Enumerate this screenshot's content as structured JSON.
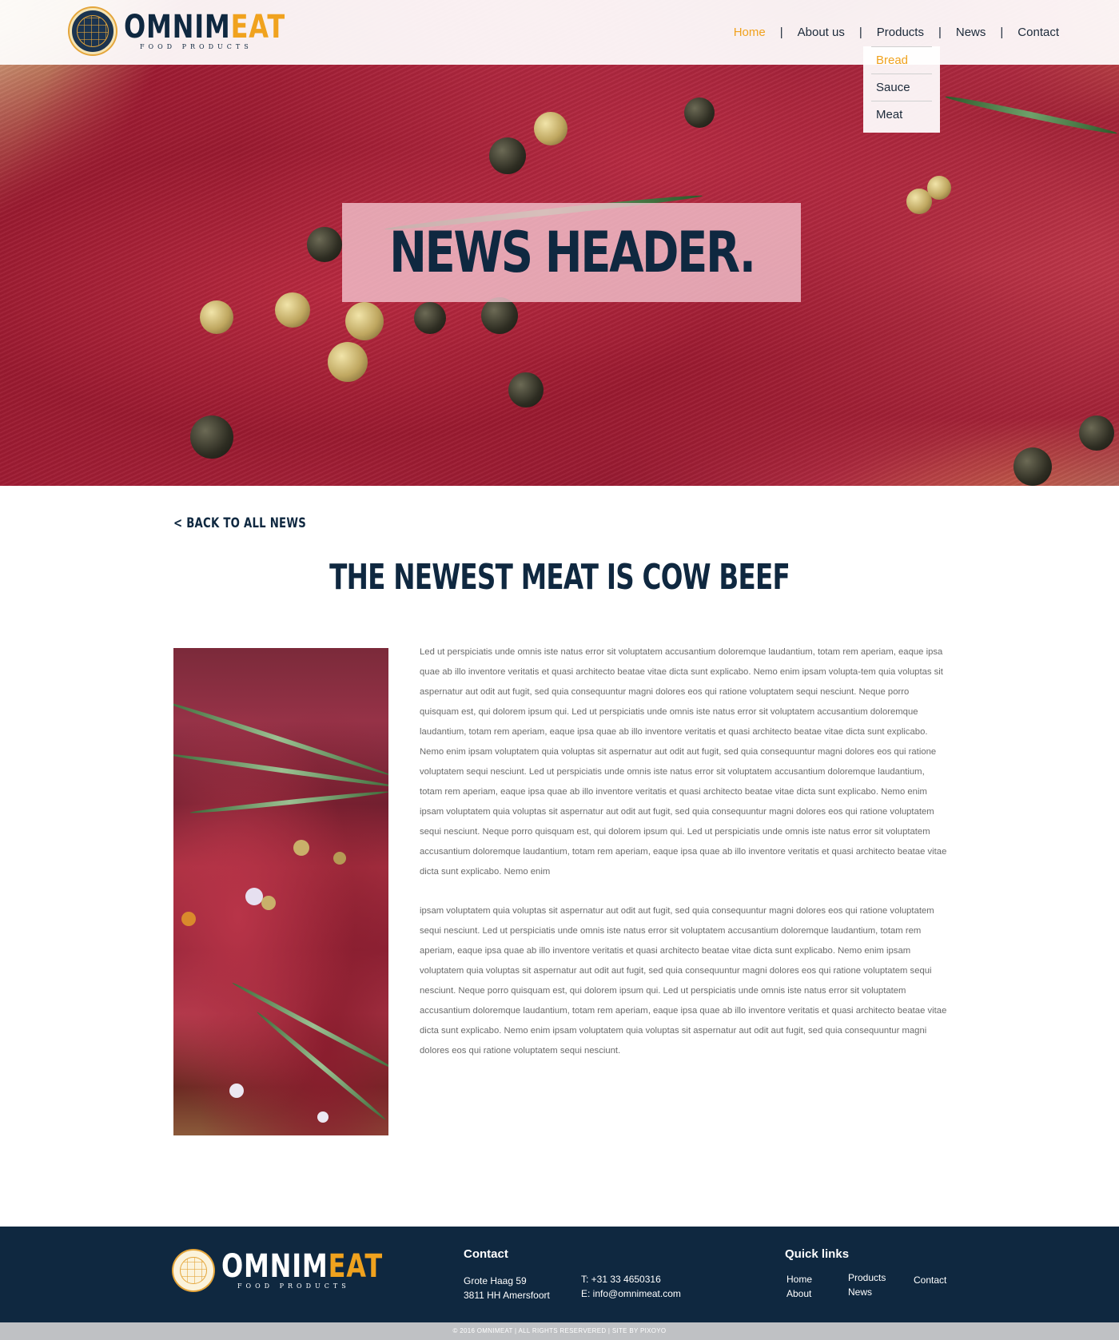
{
  "header": {
    "logo": {
      "brand_part1": "OMNIM",
      "brand_part2": "EAT",
      "tagline": "FOOD PRODUCTS"
    },
    "nav": [
      {
        "label": "Home",
        "active": true
      },
      {
        "label": "About us"
      },
      {
        "label": "Products"
      },
      {
        "label": "News"
      },
      {
        "label": "Contact"
      }
    ],
    "separator": "|",
    "products_dropdown": [
      "Bread",
      "Sauce",
      "Meat"
    ]
  },
  "hero": {
    "title": "NEWS HEADER."
  },
  "article": {
    "back_link": "< BACK TO ALL NEWS",
    "title": "THE NEWEST MEAT IS COW BEEF",
    "paragraphs": [
      "Led ut perspiciatis unde omnis iste natus error sit voluptatem accusantium doloremque laudantium, totam rem aperiam, eaque ipsa quae ab illo inventore veritatis et quasi architecto beatae vitae dicta sunt explicabo. Nemo enim ipsam volupta-tem quia voluptas sit aspernatur aut odit aut fugit, sed quia consequuntur magni dolores eos qui ratione voluptatem sequi nesciunt. Neque porro quisquam est, qui dolorem ipsum qui. Led ut perspiciatis unde omnis iste natus error sit voluptatem accusantium doloremque laudantium, totam rem aperiam, eaque ipsa quae ab illo inventore veritatis et quasi architecto beatae vitae dicta sunt explicabo. Nemo enim ipsam voluptatem quia voluptas sit aspernatur aut odit aut fugit, sed quia consequuntur magni dolores eos qui ratione voluptatem sequi nesciunt. Led ut perspiciatis unde omnis iste natus error sit voluptatem accusantium doloremque laudantium, totam rem aperiam, eaque ipsa quae ab illo inventore veritatis et quasi architecto beatae vitae dicta sunt explicabo. Nemo enim ipsam voluptatem quia voluptas sit aspernatur aut odit aut fugit, sed quia consequuntur magni dolores eos qui ratione voluptatem sequi nesciunt. Neque porro quisquam est, qui dolorem ipsum qui. Led ut perspiciatis unde omnis iste natus error sit voluptatem accusantium doloremque laudantium, totam rem aperiam, eaque ipsa quae ab illo inventore veritatis et quasi architecto beatae vitae dicta sunt explicabo. Nemo enim",
      "ipsam voluptatem quia voluptas sit aspernatur aut odit aut fugit, sed quia consequuntur magni dolores eos qui ratione voluptatem sequi nesciunt. Led ut perspiciatis unde omnis iste natus error sit voluptatem accusantium doloremque laudantium, totam rem aperiam, eaque ipsa quae ab illo inventore veritatis et quasi architecto beatae vitae dicta sunt explicabo. Nemo enim ipsam voluptatem quia voluptas sit aspernatur aut odit aut fugit, sed quia consequuntur magni dolores eos qui ratione voluptatem sequi nesciunt. Neque porro quisquam est, qui dolorem ipsum qui. Led ut perspiciatis unde omnis iste natus error sit voluptatem accusantium doloremque laudantium, totam rem aperiam, eaque ipsa quae ab illo inventore veritatis et quasi architecto beatae vitae dicta sunt explicabo. Nemo enim ipsam voluptatem quia voluptas sit aspernatur aut odit aut fugit, sed quia consequuntur magni dolores eos qui ratione voluptatem sequi nesciunt."
    ]
  },
  "footer": {
    "logo": {
      "brand_part1": "OMNIM",
      "brand_part2": "EAT",
      "tagline": "FOOD PRODUCTS"
    },
    "contact": {
      "heading": "Contact",
      "address_line1": "Grote Haag 59",
      "address_line2": "3811 HH Amersfoort",
      "phone": "T: +31 33 4650316",
      "email": "E: info@omnimeat.com"
    },
    "quick_links": {
      "heading": "Quick links",
      "home": "Home",
      "about": "About",
      "products": "Products",
      "news": "News",
      "contact": "Contact"
    }
  },
  "copyright": "© 2016 OMNIMEAT  |  ALL RIGHTS RESERVERED  |  SITE BY PIXOYO",
  "colors": {
    "navy": "#0f2840",
    "accent_orange": "#f0a21e",
    "copyright_bar": "#bfc1c4"
  }
}
